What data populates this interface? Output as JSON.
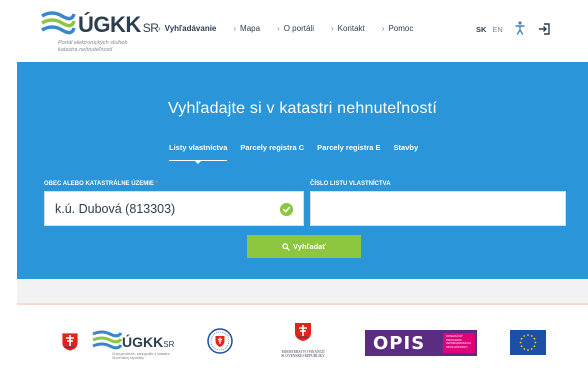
{
  "header": {
    "logo": {
      "name": "ÚGKK",
      "suffix": "SR",
      "subtitle": "Portál elektronických služieb katastra nehnuteľností"
    },
    "nav": [
      {
        "label": "Vyhľadávanie"
      },
      {
        "label": "Mapa"
      },
      {
        "label": "O portáli"
      },
      {
        "label": "Kontakt"
      },
      {
        "label": "Pomoc"
      }
    ],
    "lang": {
      "active": "SK",
      "inactive": "EN"
    },
    "icons": {
      "accessibility": "accessibility-icon",
      "login": "login-icon"
    }
  },
  "hero": {
    "title": "Vyhľadajte si v katastri nehnuteľností",
    "tabs": [
      {
        "label": "Listy vlastníctva",
        "active": true
      },
      {
        "label": "Parcely registra C",
        "active": false
      },
      {
        "label": "Parcely registra E",
        "active": false
      },
      {
        "label": "Stavby",
        "active": false
      }
    ],
    "form": {
      "left_label": "OBEC ALEBO KATASTRÁLNE ÚZEMIE",
      "left_required": "*",
      "left_value": "k.ú. Dubová (813303)",
      "right_label": "ČÍSLO LISTU VLASTNÍCTVA",
      "right_value": "",
      "search_label": "Vyhľadať"
    }
  },
  "footer": {
    "ugkk": {
      "name": "ÚGKK",
      "suffix": "SR",
      "subtitle": "Úrad geodézie, kartografie a katastra Slovenskej republiky"
    },
    "ministry": "MINISTERSTVO FINANCIÍ SLOVENSKEJ REPUBLIKY",
    "opis": {
      "name": "OPIS",
      "tagline": "OPERAČNÝ PROGRAM INFORMATIZÁCIA SPOLOČNOSTI"
    }
  },
  "colors": {
    "hero_bg": "#2a95d8",
    "button_green": "#8dc63f",
    "opis_purple": "#5b2d82",
    "opis_pink": "#e2007a",
    "eu_blue": "#1e4fa7"
  }
}
